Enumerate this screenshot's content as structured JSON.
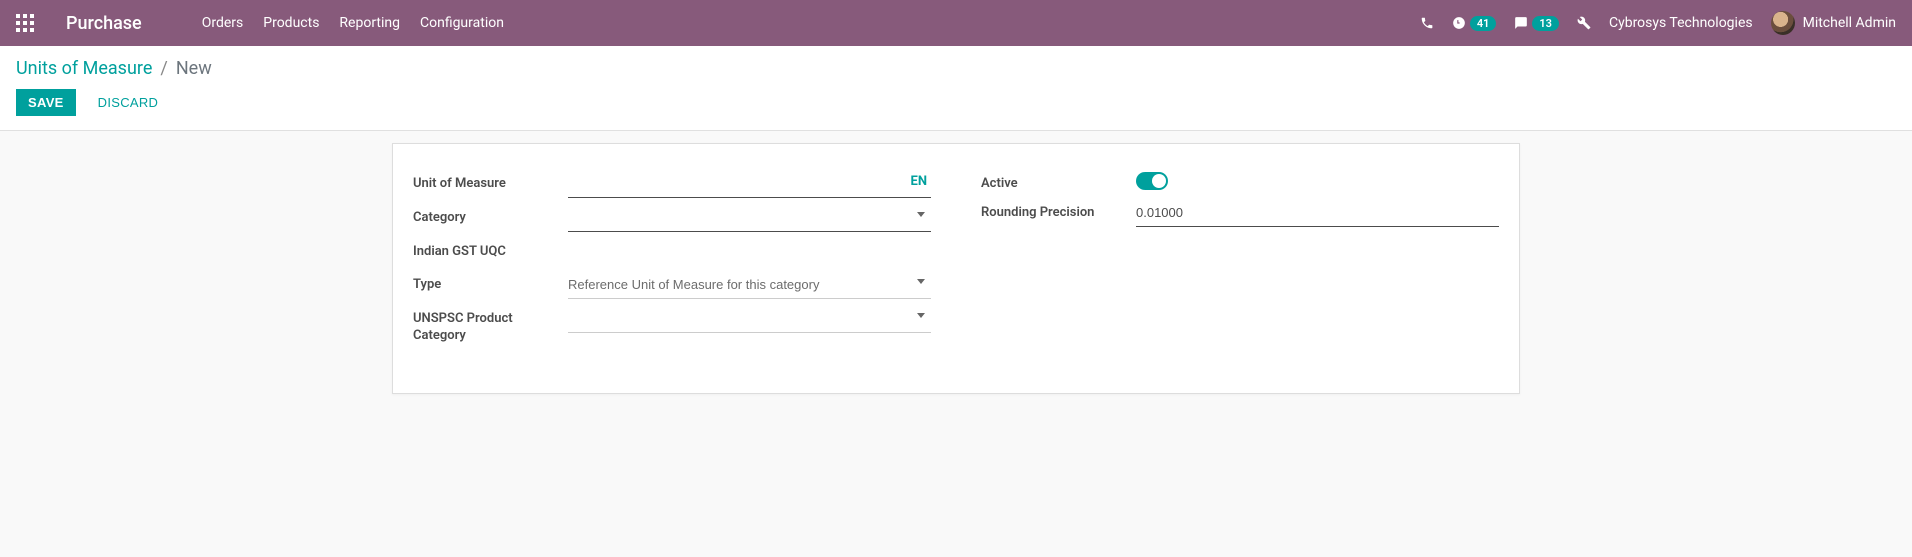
{
  "navbar": {
    "brand": "Purchase",
    "menu": [
      "Orders",
      "Products",
      "Reporting",
      "Configuration"
    ],
    "activities_badge": "41",
    "discuss_badge": "13",
    "company": "Cybrosys Technologies",
    "user": "Mitchell Admin"
  },
  "breadcrumb": {
    "parent": "Units of Measure",
    "separator": "/",
    "current": "New"
  },
  "buttons": {
    "save": "SAVE",
    "discard": "DISCARD"
  },
  "form": {
    "left": {
      "unit_of_measure_label": "Unit of Measure",
      "unit_of_measure_value": "",
      "lang_badge": "EN",
      "category_label": "Category",
      "category_value": "",
      "indian_gst_label": "Indian GST UQC",
      "indian_gst_value": "",
      "type_label": "Type",
      "type_value": "Reference Unit of Measure for this category",
      "unspsc_label": "UNSPSC Product Category",
      "unspsc_value": ""
    },
    "right": {
      "active_label": "Active",
      "active_value": "on",
      "rounding_label": "Rounding Precision",
      "rounding_value": "0.01000"
    }
  }
}
